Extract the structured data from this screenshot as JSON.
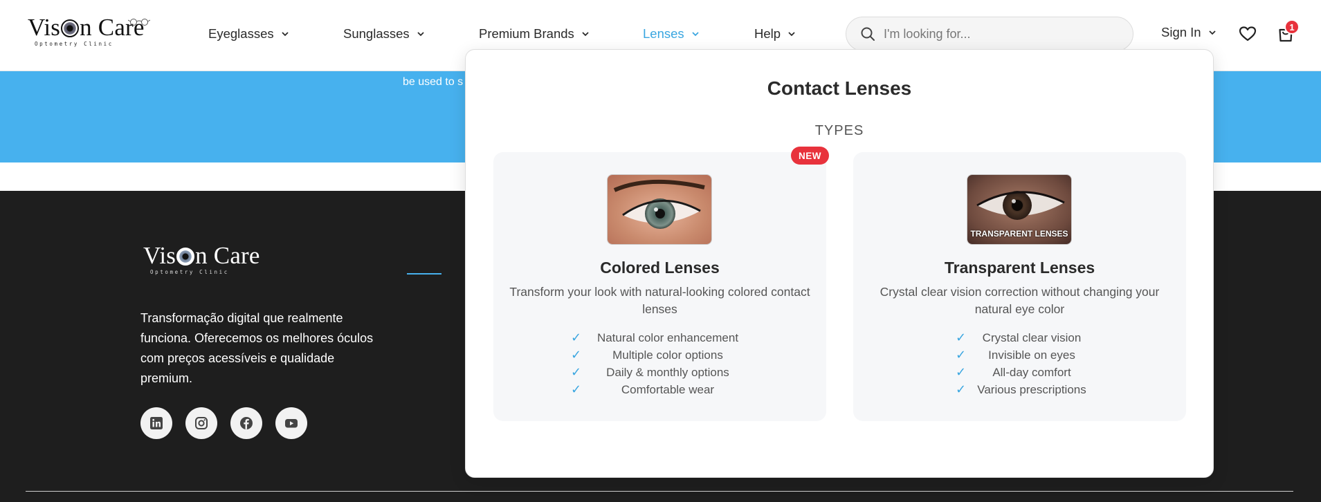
{
  "brand": {
    "name_left": "Vis",
    "name_right": "n Care",
    "tagline": "Optometry   Clinic"
  },
  "nav": {
    "eyeglasses": "Eyeglasses",
    "sunglasses": "Sunglasses",
    "premium_brands": "Premium Brands",
    "lenses": "Lenses",
    "help": "Help"
  },
  "search": {
    "placeholder": "I'm looking for..."
  },
  "account": {
    "sign_in": "Sign In"
  },
  "cart": {
    "count": "1"
  },
  "band": {
    "line1": "...",
    "line2": "be used to s"
  },
  "dropdown": {
    "title": "Contact Lenses",
    "subtitle": "TYPES",
    "cards": [
      {
        "badge": "NEW",
        "title": "Colored Lenses",
        "description": "Transform your look with natural-looking colored contact lenses",
        "features": [
          "Natural color enhancement",
          "Multiple color options",
          "Daily & monthly options",
          "Comfortable wear"
        ]
      },
      {
        "image_label": "TRANSPARENT LENSES",
        "title": "Transparent Lenses",
        "description": "Crystal clear vision correction without changing your natural eye color",
        "features": [
          "Crystal clear vision",
          "Invisible on eyes",
          "All-day comfort",
          "Various prescriptions"
        ]
      }
    ]
  },
  "footer": {
    "description": "Transformação digital que realmente funciona. Oferecemos os melhores óculos com preços acessíveis e qualidade premium.",
    "social": [
      "linkedin-icon",
      "instagram-icon",
      "facebook-icon",
      "youtube-icon"
    ]
  },
  "colors": {
    "accent": "#47b1ee",
    "badge": "#e8323c",
    "footer_bg": "#1e1e1e"
  }
}
